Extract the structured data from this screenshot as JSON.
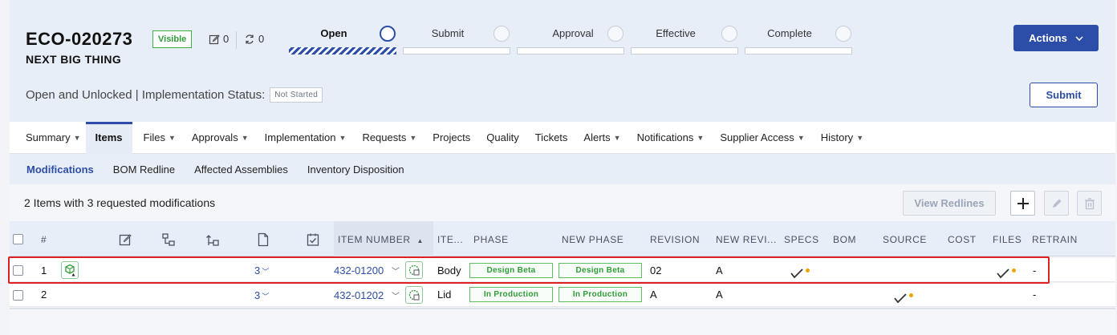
{
  "header": {
    "eco_id": "ECO-020273",
    "eco_name": "NEXT BIG THING",
    "visibility_badge": "Visible",
    "edit_count": "0",
    "sync_count": "0",
    "status_text": "Open and Unlocked | Implementation Status:",
    "implementation_status": "Not Started",
    "actions_label": "Actions",
    "submit_label": "Submit",
    "workflow_steps": [
      {
        "label": "Open",
        "state": "active"
      },
      {
        "label": "Submit",
        "state": "pending"
      },
      {
        "label": "Approval",
        "state": "pending"
      },
      {
        "label": "Effective",
        "state": "pending"
      },
      {
        "label": "Complete",
        "state": "pending"
      }
    ]
  },
  "tabs": {
    "summary": "Summary",
    "items": "Items",
    "files": "Files",
    "approvals": "Approvals",
    "implementation": "Implementation",
    "requests": "Requests",
    "projects": "Projects",
    "quality": "Quality",
    "tickets": "Tickets",
    "alerts": "Alerts",
    "notifications": "Notifications",
    "supplier_access": "Supplier Access",
    "history": "History"
  },
  "subtabs": {
    "modifications": "Modifications",
    "bom_redline": "BOM Redline",
    "affected_assemblies": "Affected Assemblies",
    "inventory_disposition": "Inventory Disposition"
  },
  "toolbar": {
    "summary": "2 Items with 3 requested modifications",
    "view_redlines": "View Redlines"
  },
  "table": {
    "columns": {
      "num": "#",
      "item_number": "ITEM NUMBER",
      "item_name": "ITE...",
      "phase": "PHASE",
      "new_phase": "NEW PHASE",
      "revision": "REVISION",
      "new_revision": "NEW REVI...",
      "specs": "SPECS",
      "bom": "BOM",
      "source": "SOURCE",
      "cost": "COST",
      "files": "FILES",
      "retrain": "RETRAIN"
    },
    "rows": [
      {
        "num": "1",
        "count": "3",
        "item_number": "432-01200",
        "item_name": "Body",
        "phase": "Design Beta",
        "new_phase": "Design Beta",
        "revision": "02",
        "new_revision": "A",
        "retrain": "-"
      },
      {
        "num": "2",
        "count": "3",
        "item_number": "432-01202",
        "item_name": "Lid",
        "phase": "In Production",
        "new_phase": "In Production",
        "revision": "A",
        "new_revision": "A",
        "retrain": "-"
      }
    ]
  },
  "colors": {
    "accent": "#2d4ea8",
    "phase_green": "#2f9d37",
    "warning_dot": "#f0a500",
    "highlight": "#e02020"
  }
}
